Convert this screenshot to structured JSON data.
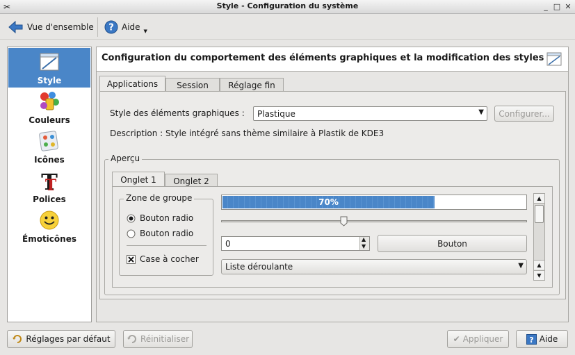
{
  "window": {
    "title": "Style - Configuration du système",
    "controls": [
      "_",
      "□",
      "✕"
    ]
  },
  "toolbar": {
    "overview_label": "Vue d'ensemble",
    "help_label": "Aide"
  },
  "sidebar": {
    "items": [
      {
        "label": "Style",
        "icon": "style-icon",
        "selected": true
      },
      {
        "label": "Couleurs",
        "icon": "colors-icon"
      },
      {
        "label": "Icônes",
        "icon": "icons-icon"
      },
      {
        "label": "Polices",
        "icon": "fonts-icon"
      },
      {
        "label": "Émoticônes",
        "icon": "emoticons-icon"
      }
    ]
  },
  "header": {
    "text": "Configuration du comportement des éléments graphiques et la modification des styles de"
  },
  "tabs": [
    {
      "label": "Applications",
      "active": true
    },
    {
      "label": "Session"
    },
    {
      "label": "Réglage fin"
    }
  ],
  "style_row": {
    "label": "Style des éléments graphiques :",
    "value": "Plastique",
    "configure_label": "Configurer..."
  },
  "description": "Description : Style intégré sans thème similaire à Plastik de KDE3",
  "preview": {
    "legend": "Aperçu",
    "tabs": [
      {
        "label": "Onglet 1",
        "active": true
      },
      {
        "label": "Onglet 2"
      }
    ],
    "groupbox_title": "Zone de groupe",
    "radio1": "Bouton radio",
    "radio2": "Bouton radio",
    "checkbox": "Case à cocher",
    "progress_text": "70%",
    "progress_value": 0.7,
    "slider_value": 0.4,
    "spin_value": "0",
    "button_label": "Bouton",
    "combo_value": "Liste déroulante"
  },
  "footer": {
    "defaults_label": "Réglages par défaut",
    "reset_label": "Réinitialiser",
    "apply_label": "Appliquer",
    "help_label": "Aide"
  },
  "colors": {
    "selection": "#4a86c8",
    "progress": "#4a86c8"
  }
}
